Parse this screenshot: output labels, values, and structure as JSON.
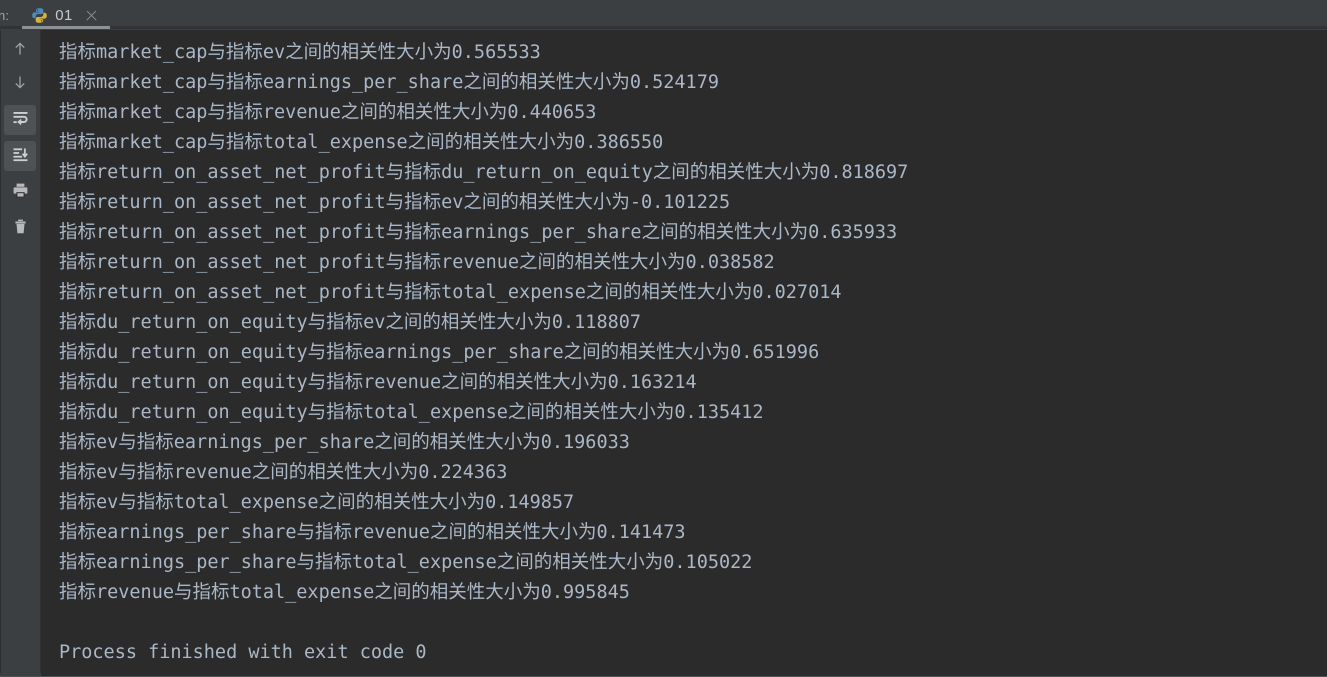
{
  "window": {
    "run_label": "n:",
    "background": "#3c3f41",
    "console_background": "#2b2b2b",
    "text_color": "#a9b7c6"
  },
  "tab": {
    "icon": "python-file-icon",
    "label": "01",
    "close_label": "×"
  },
  "toolbar": {
    "items": [
      {
        "name": "scroll-up-button",
        "icon": "arrow-up-icon",
        "active": false
      },
      {
        "name": "scroll-down-button",
        "icon": "arrow-down-icon",
        "active": false
      },
      {
        "name": "soft-wrap-button",
        "icon": "soft-wrap-icon",
        "active": true
      },
      {
        "name": "scroll-to-end-button",
        "icon": "scroll-to-end-icon",
        "active": true
      },
      {
        "name": "print-button",
        "icon": "printer-icon",
        "active": false
      },
      {
        "name": "clear-all-button",
        "icon": "trash-icon",
        "active": false
      }
    ]
  },
  "console": {
    "lines": [
      "指标market_cap与指标ev之间的相关性大小为0.565533",
      "指标market_cap与指标earnings_per_share之间的相关性大小为0.524179",
      "指标market_cap与指标revenue之间的相关性大小为0.440653",
      "指标market_cap与指标total_expense之间的相关性大小为0.386550",
      "指标return_on_asset_net_profit与指标du_return_on_equity之间的相关性大小为0.818697",
      "指标return_on_asset_net_profit与指标ev之间的相关性大小为-0.101225",
      "指标return_on_asset_net_profit与指标earnings_per_share之间的相关性大小为0.635933",
      "指标return_on_asset_net_profit与指标revenue之间的相关性大小为0.038582",
      "指标return_on_asset_net_profit与指标total_expense之间的相关性大小为0.027014",
      "指标du_return_on_equity与指标ev之间的相关性大小为0.118807",
      "指标du_return_on_equity与指标earnings_per_share之间的相关性大小为0.651996",
      "指标du_return_on_equity与指标revenue之间的相关性大小为0.163214",
      "指标du_return_on_equity与指标total_expense之间的相关性大小为0.135412",
      "指标ev与指标earnings_per_share之间的相关性大小为0.196033",
      "指标ev与指标revenue之间的相关性大小为0.224363",
      "指标ev与指标total_expense之间的相关性大小为0.149857",
      "指标earnings_per_share与指标revenue之间的相关性大小为0.141473",
      "指标earnings_per_share与指标total_expense之间的相关性大小为0.105022",
      "指标revenue与指标total_expense之间的相关性大小为0.995845",
      "",
      "Process finished with exit code 0"
    ]
  }
}
